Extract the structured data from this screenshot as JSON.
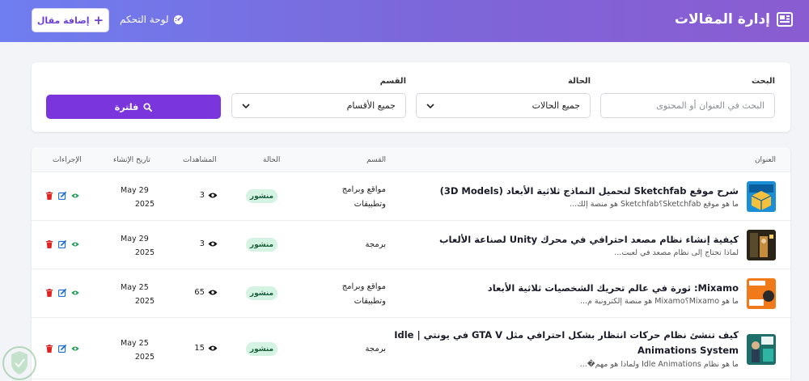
{
  "header": {
    "title": "إدارة المقالات",
    "dashboard_label": "لوحة التحكم",
    "add_button_label": "إضافة مقال"
  },
  "filters": {
    "search": {
      "label": "البحث",
      "placeholder": "البحث في العنوان أو المحتوى"
    },
    "status": {
      "label": "الحالة",
      "selected": "جميع الحالات"
    },
    "category": {
      "label": "القسم",
      "selected": "جميع الأقسام"
    },
    "submit_label": "فلترة"
  },
  "table": {
    "headers": {
      "title": "العنوان",
      "category": "القسم",
      "status": "الحالة",
      "views": "المشاهدات",
      "created": "تاريخ الإنشاء",
      "actions": "الإجراءات"
    },
    "rows": [
      {
        "title": "شرح موقع Sketchfab لتحميل النماذج ثلاثية الأبعاد (3D Models)",
        "excerpt": "ما هو موقع Sketchfab؟Sketchfab هو منصة إلك...",
        "category_line1": "مواقع وبرامج",
        "category_line2": "وتطبيقات",
        "status": "منشور",
        "views": "3",
        "date_line1": "May 29",
        "date_line2": "2025",
        "thumb_icon": "3d-models-thumbnail-icon"
      },
      {
        "title": "كيفية إنشاء نظام مصعد احترافي في محرك Unity لصناعة الألعاب",
        "excerpt": "لماذا تحتاج إلى نظام مصعد في لعبت...",
        "category_line1": "برمجة",
        "category_line2": "",
        "status": "منشور",
        "views": "3",
        "date_line1": "May 29",
        "date_line2": "2025",
        "thumb_icon": "unity-elevator-thumbnail-icon"
      },
      {
        "title": "Mixamo: ثورة في عالم تحريك الشخصيات ثلاثية الأبعاد",
        "excerpt": "ما هو Mixamo؟Mixamo هو منصة إلكترونية م...",
        "category_line1": "مواقع وبرامج",
        "category_line2": "وتطبيقات",
        "status": "منشور",
        "views": "65",
        "date_line1": "May 25",
        "date_line2": "2025",
        "thumb_icon": "mixamo-thumbnail-icon"
      },
      {
        "title_line1": "كيف تنشئ نظام حركات انتظار بشكل احترافي مثل GTA V في يونتي | Idle",
        "title_line2": "Animations System",
        "excerpt": "ما هو نظام Idle Animations ولماذا هو مهم�...",
        "category_line1": "برمجة",
        "category_line2": "",
        "status": "منشور",
        "views": "15",
        "date_line1": "May 25",
        "date_line2": "2025",
        "thumb_icon": "idle-animations-thumbnail-icon"
      }
    ]
  },
  "colors": {
    "header_start": "#6f7ef0",
    "header_end": "#8a5cd1",
    "primary": "#7a35dc",
    "badge_bg": "#d4f3e2",
    "badge_text": "#1a5e3a",
    "delete": "#e02424",
    "edit": "#1e6fd9",
    "view": "#1f9d55"
  }
}
